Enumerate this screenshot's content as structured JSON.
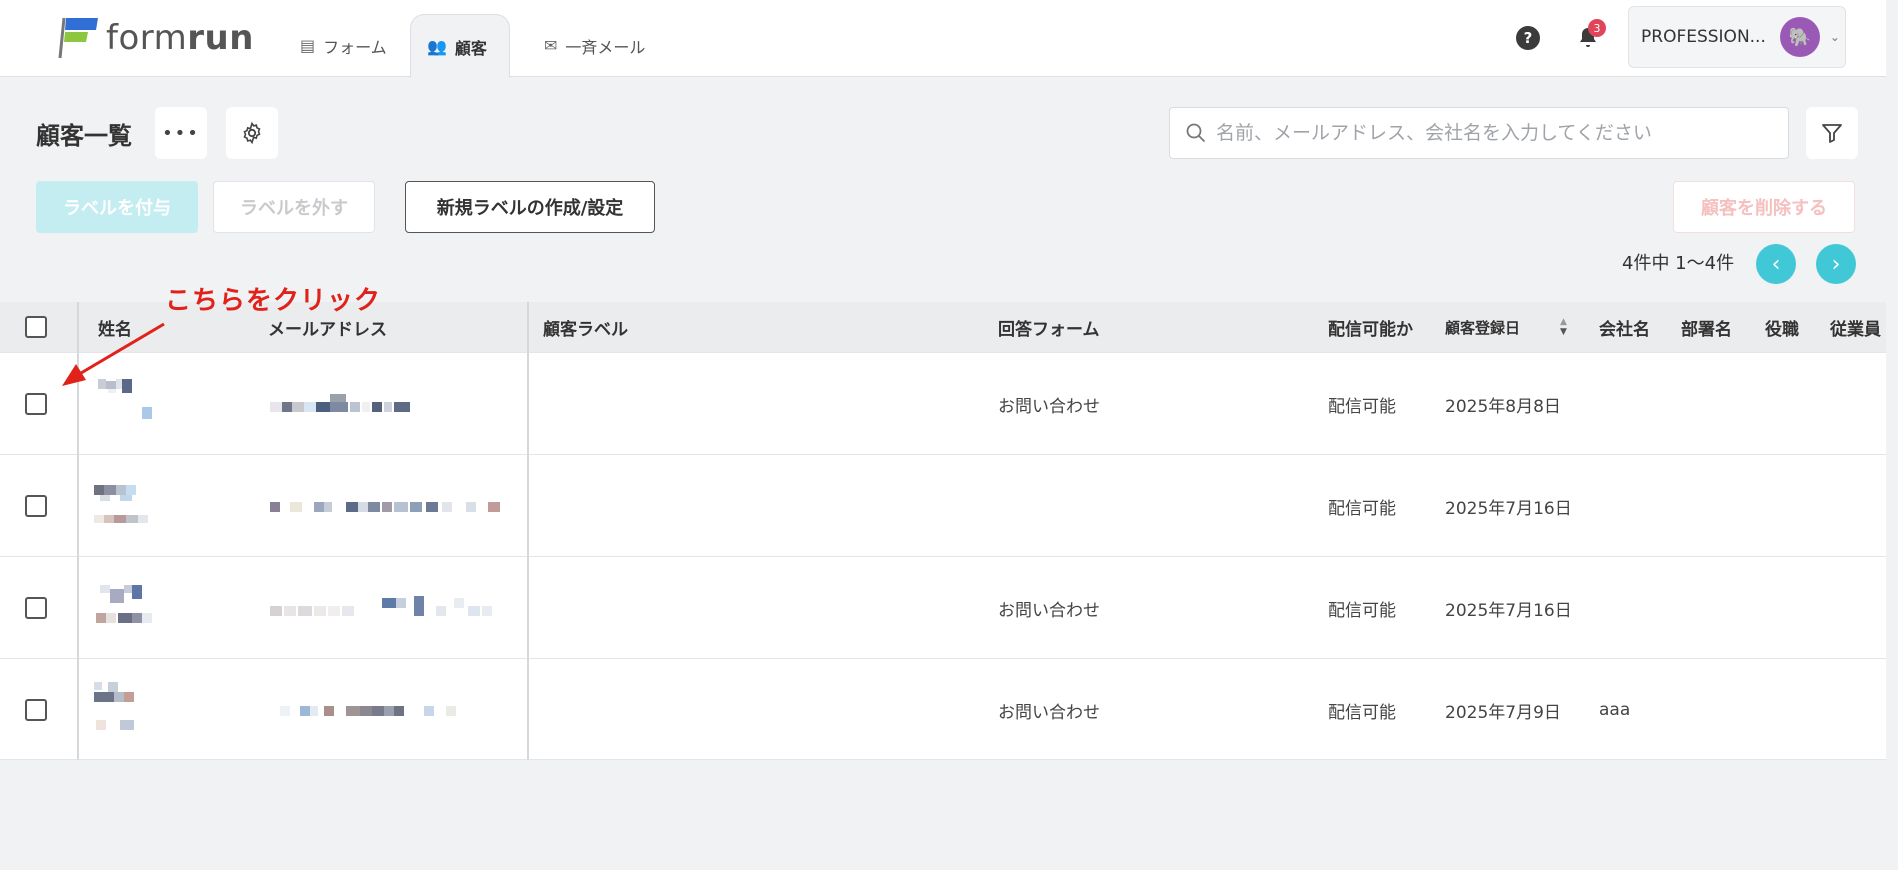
{
  "header": {
    "logo_text_regular": "form",
    "logo_text_bold": "run",
    "tabs": [
      {
        "label": "フォーム",
        "icon": "form-icon"
      },
      {
        "label": "顧客",
        "icon": "people-icon"
      },
      {
        "label": "一斉メール",
        "icon": "mail-icon"
      }
    ],
    "help_label": "?",
    "notification_count": "3",
    "account_label": "PROFESSION..."
  },
  "toolbar": {
    "title": "顧客一覧",
    "more_label": "•••",
    "search_placeholder": "名前、メールアドレス、会社名を入力してください",
    "add_label_button": "ラベルを付与",
    "remove_label_button": "ラベルを外す",
    "new_label_button": "新規ラベルの作成/設定",
    "delete_button": "顧客を削除する",
    "paging_text": "4件中 1〜4件",
    "prev_label": "‹",
    "next_label": "›"
  },
  "table": {
    "columns": [
      "姓名",
      "メールアドレス",
      "顧客ラベル",
      "回答フォーム",
      "配信可能か",
      "顧客登録日",
      "会社名",
      "部署名",
      "役職",
      "従業員"
    ],
    "rows": [
      {
        "form": "お問い合わせ",
        "deliverable": "配信可能",
        "registered": "2025年8月8日",
        "company": ""
      },
      {
        "form": "",
        "deliverable": "配信可能",
        "registered": "2025年7月16日",
        "company": ""
      },
      {
        "form": "お問い合わせ",
        "deliverable": "配信可能",
        "registered": "2025年7月16日",
        "company": ""
      },
      {
        "form": "お問い合わせ",
        "deliverable": "配信可能",
        "registered": "2025年7月9日",
        "company": "aaa"
      }
    ]
  },
  "annotation": {
    "text": "こちらをクリック",
    "color": "#e0221b"
  },
  "colors": {
    "accent": "#40c8d6",
    "badge": "#e0455a",
    "avatar": "#9b59b6"
  }
}
